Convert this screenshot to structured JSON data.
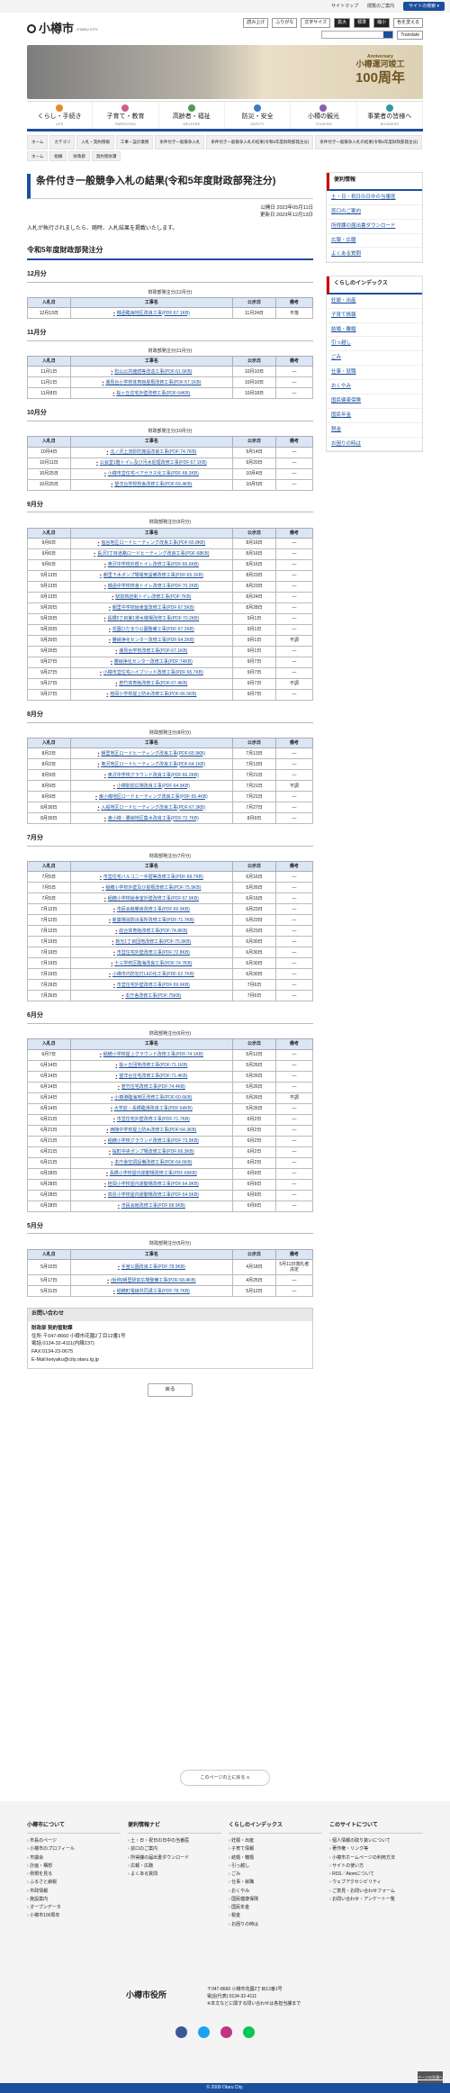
{
  "topbar": {
    "sitemap": "サイトマップ",
    "howto": "閲覧のご案内",
    "external": "サイトの検索 ▾"
  },
  "header": {
    "city": "小樽市",
    "city_en": "OTARU CITY",
    "tools": [
      "読み上げ",
      "ふりがな",
      "文字サイズ",
      "拡大",
      "標準",
      "縮小",
      "色を変える"
    ],
    "search_label": "サイト内検索",
    "translate": "Translate"
  },
  "banner": {
    "line1": "Anniversary",
    "line2": "小樽運河竣工",
    "line3": "100周年"
  },
  "gnav": [
    {
      "label": "くらし・手続き",
      "sub": "LIFE"
    },
    {
      "label": "子育て・教育",
      "sub": "PARENTING"
    },
    {
      "label": "高齢者・福祉",
      "sub": "WELFARE"
    },
    {
      "label": "防災・安全",
      "sub": "SAFETY"
    },
    {
      "label": "小樽の観光",
      "sub": "TOURISM"
    },
    {
      "label": "事業者の皆様へ",
      "sub": "BUSINESS"
    }
  ],
  "breadcrumb": [
    "ホーム",
    "カテゴリ",
    "入札・契約情報",
    "工事・設計業務",
    "条件付き一般競争入札",
    "条件付き一般競争入札の結果(令和5年度財政部発注分)",
    "条件付き一般競争入札の結果(令和5年度財政部発注分)"
  ],
  "breadcrumb2": [
    "ホーム",
    "組織",
    "財政部",
    "契約管財課"
  ],
  "page": {
    "title": "条件付き一般競争入札の結果(令和5年度財政部発注分)",
    "published": "公開日 2023年05月11日",
    "updated": "更新日 2023年12月13日",
    "intro": "入札が執行されましたら、随時、入札結果を掲載いたします。",
    "section": "令和5年度財政部発注分"
  },
  "table_headers": {
    "date": "入札日",
    "work": "工事名",
    "notice": "公示日",
    "remark": "備考"
  },
  "months": [
    {
      "title": "12月分",
      "caption": "財政部発注分(12月分)",
      "rows": [
        [
          "12月13日",
          "銭函臨海地区改良工事(PDF:67.1KB)",
          "11月24日",
          "不落"
        ]
      ]
    },
    {
      "title": "11月分",
      "caption": "財政部発注分(11月分)",
      "rows": [
        [
          "11月1日",
          "松山公共継続等改造工事(PDF:61.6KB)",
          "10月10日",
          "―"
        ],
        [
          "11月1日",
          "潮見台小学校体育館屋根改修工事(PDF:57.1KB)",
          "10月10日",
          "―"
        ],
        [
          "11月8日",
          "桜ヶ丘住宅外壁改修工事(PDF:64KB)",
          "10月18日",
          "―"
        ]
      ]
    },
    {
      "title": "10月分",
      "caption": "財政部発注分(10月分)",
      "rows": [
        [
          "10月4日",
          "北ノ沢上流砂防施設改良工事(PDF:74.7KB)",
          "9月14日",
          "―"
        ],
        [
          "10月11日",
          "公会堂1階トイレ及び汚水処理改修工事(PDF:67.1KB)",
          "9月20日",
          "―"
        ],
        [
          "10月25日",
          "小樽市営住宅ペアガラス化工事(PDF:68.3KB)",
          "10月4日",
          "―"
        ],
        [
          "10月25日",
          "望洋台学校校舎改修工事(PDF:69.4KB)",
          "10月5日",
          "―"
        ]
      ]
    },
    {
      "title": "9月分",
      "caption": "財政部発注分(9月分)",
      "rows": [
        [
          "9月6日",
          "塩谷地区ロードヒーティング改良工事(PDF:65.8KB)",
          "8月16日",
          "―"
        ],
        [
          "9月6日",
          "長沢3丁目道路ロードヒーティング改良工事(PDF:68KB)",
          "8月16日",
          "―"
        ],
        [
          "9月6日",
          "奥沢中学校外部トイレ改修工事(PDF:66.6KB)",
          "8月16日",
          "―"
        ],
        [
          "9月13日",
          "朝里下水ポンプ場電気設備改修工事(PDF:65.1KB)",
          "8月23日",
          "―"
        ],
        [
          "9月13日",
          "銭函中学校校舎トイレ改修工事(PDF:70.2KB)",
          "8月23日",
          "―"
        ],
        [
          "9月13日",
          "駅前商店街トイレ改修工事(PDF:7KB)",
          "8月24日",
          "―"
        ],
        [
          "9月20日",
          "朝里中学校給食室改修工事(PDF:67.5KB)",
          "8月28日",
          "―"
        ],
        [
          "9月20日",
          "長橋5丁目第1排水機場改修工事(PDF:70.2KB)",
          "9月1日",
          "―"
        ],
        [
          "9月20日",
          "花園ひだまり公園整備工事(PDF:67.2KB)",
          "9月1日",
          "―"
        ],
        [
          "9月20日",
          "勝納浄化センター改修工事(PDF:64.2KB)",
          "9月1日",
          "不調"
        ],
        [
          "9月20日",
          "潮見台学校改修工事(PDF:67.1KB)",
          "9月1日",
          "―"
        ],
        [
          "9月27日",
          "勝納浄化センター改修工事(PDF:74KB)",
          "9月7日",
          "―"
        ],
        [
          "9月27日",
          "小樽市営住宅ハイブリッド改修工事(PDF:65.7KB)",
          "9月7日",
          "―"
        ],
        [
          "9月27日",
          "若竹体育館改修工事(PDF:67.4KB)",
          "9月7日",
          "不調"
        ],
        [
          "9月27日",
          "桂岡小学校屋上防水改修工事(PDF:66.5KB)",
          "9月7日",
          "―"
        ]
      ]
    },
    {
      "title": "8月分",
      "caption": "財政部発注分(8月分)",
      "rows": [
        [
          "8月2日",
          "朝里地区ロードヒーティング改良工事(PDF:65.9KB)",
          "7月13日",
          "―"
        ],
        [
          "8月2日",
          "奥沢地区ロードヒーティング改良工事(PDF:64.1KB)",
          "7月13日",
          "―"
        ],
        [
          "8月9日",
          "奥沢中学校グラウンド改良工事(PDF:66.2KB)",
          "7月21日",
          "―"
        ],
        [
          "8月9日",
          "小樽駅前広場改良工事(PDF:64.9KB)",
          "7月21日",
          "不調"
        ],
        [
          "8月9日",
          "東小樽地区ロードヒーティング改良工事(PDF:65.4KB)",
          "7月21日",
          "―"
        ],
        [
          "8月30日",
          "入船地区ロードヒーティング改良工事(PDF:67.3KB)",
          "7月27日",
          "―"
        ],
        [
          "8月30日",
          "東小樽・勝納地区集水改良工事(PDF:72.7KB)",
          "8月9日",
          "―"
        ]
      ]
    },
    {
      "title": "7月分",
      "caption": "財政部発注分(7月分)",
      "rows": [
        [
          "7月5日",
          "市営住宅バルコニー手摺等改修工事(PDF:69.7KB)",
          "6月16日",
          "―"
        ],
        [
          "7月5日",
          "稲穂小学校外壁及び屋根改修工事(PDF:75.9KB)",
          "5月26日",
          "―"
        ],
        [
          "7月5日",
          "稲穂小学校給食室外壁改修工事(PDF:67.9KB)",
          "6月16日",
          "―"
        ],
        [
          "7月12日",
          "市民会館暖房改修工事(PDF:69.9KB)",
          "6月23日",
          "―"
        ],
        [
          "7月12日",
          "新築場消防出張所改修工事(PDF:71.7KB)",
          "6月23日",
          "―"
        ],
        [
          "7月12日",
          "総合体育館改修工事(PDF:74.8KB)",
          "6月23日",
          "―"
        ],
        [
          "7月19日",
          "新光1丁目団地改修工事(PDF:75.9KB)",
          "6月30日",
          "―"
        ],
        [
          "7月19日",
          "市営住宅外壁改修工事(PDF:72.8KB)",
          "6月30日",
          "―"
        ],
        [
          "7月19日",
          "十三学校区臨海改良工事(PDF:74.7KB)",
          "6月30日",
          "―"
        ],
        [
          "7月19日",
          "小樽市内防犯灯LED化工事(PDF:62.7KB)",
          "6月30日",
          "―"
        ],
        [
          "7月26日",
          "市営住宅外壁改修工事(PDF:69.6KB)",
          "7月6日",
          "―"
        ],
        [
          "7月26日",
          "本庁舎改修工事(PDF:75KB)",
          "7月6日",
          "―"
        ]
      ]
    },
    {
      "title": "6月分",
      "caption": "財政部発注分(6月分)",
      "rows": [
        [
          "6月7日",
          "稲穂小学校屋上グラウンド改修工事(PDF:74.1KB)",
          "5月12日",
          "―"
        ],
        [
          "6月14日",
          "桜ヶ丘団地改修工事(PDF:71.1KB)",
          "5月26日",
          "―"
        ],
        [
          "6月14日",
          "望洋台住宅改修工事(PDF:71.4KB)",
          "5月26日",
          "―"
        ],
        [
          "6月14日",
          "若竹住宅改修工事(PDF:74.4KB)",
          "5月26日",
          "―"
        ],
        [
          "6月14日",
          "小樽港臨海地区改修工事(PDF:60.6KB)",
          "5月26日",
          "不調"
        ],
        [
          "6月14日",
          "大学前・長橋臨港改良工事(PDF:64KB)",
          "5月26日",
          "―"
        ],
        [
          "6月21日",
          "市営住宅外壁改修工事(PDF:71.7KB)",
          "6月2日",
          "―"
        ],
        [
          "6月21日",
          "西陵中学校屋上防水改修工事(PDF:64.3KB)",
          "6月2日",
          "―"
        ],
        [
          "6月21日",
          "稲穂小学校グラウンド改修工事(PDF:73.9KB)",
          "6月2日",
          "―"
        ],
        [
          "6月21日",
          "桜町中央ポンプ場改修工事(PDF:66.3KB)",
          "6月2日",
          "―"
        ],
        [
          "6月21日",
          "本庁舎空調設備改修工事(PDF:64.6KB)",
          "6月2日",
          "―"
        ],
        [
          "6月28日",
          "長橋小学校屋内運動場改修工事(PDF:69KB)",
          "6月9日",
          "―"
        ],
        [
          "6月28日",
          "桂岡小学校屋内運動場改修工事(PDF:64.9KB)",
          "6月9日",
          "―"
        ],
        [
          "6月28日",
          "高島小学校屋内運動場改修工事(PDF:64.5KB)",
          "6月9日",
          "―"
        ],
        [
          "6月28日",
          "市民会館改修工事(PDF:68.9KB)",
          "6月9日",
          "―"
        ]
      ]
    },
    {
      "title": "5月分",
      "caption": "財政部発注分(5月分)",
      "rows": [
        [
          "5月10日",
          "手宮公園改良工事(PDF:78.9KB)",
          "4月18日",
          "5月11日落札者決定"
        ],
        [
          "5月17日",
          "(仮称)朝里駅前広場整備工事(PDF:68.4KB)",
          "4月25日",
          "―"
        ],
        [
          "5月31日",
          "稲穂町電線共同溝工事(PDF:78.7KB)",
          "5月12日",
          "―"
        ]
      ]
    }
  ],
  "contact": {
    "title": "お問い合わせ",
    "dept": "財政部 契約管財課",
    "lines": [
      "住所:〒047-8660 小樽市花園2丁目12番1号",
      "電話:0134-32-4111(内線237)",
      "FAX:0134-23-0675",
      "E-Mail:keiyaku@city.otaru.lg.jp"
    ]
  },
  "back": "戻る",
  "side1": {
    "title": "便利情報",
    "links": [
      "土・日・祝日の日中の当番医",
      "窓口のご案内",
      "所得課の届出書ダウンロード",
      "広報・広聴",
      "よくある質問"
    ]
  },
  "side2": {
    "title": "くらしのインデックス",
    "links": [
      "妊娠・出産",
      "子育て情報",
      "結婚・離婚",
      "引っ越し",
      "ごみ",
      "仕事・就職",
      "おくやみ",
      "国民健康保険",
      "国民年金",
      "税金",
      "お困りの時は"
    ]
  },
  "gotop": "このページの上に戻る ∧",
  "footer": {
    "cols": [
      {
        "title": "小樽市について",
        "links": [
          "市長のページ",
          "小樽市のプロフィール",
          "市議会",
          "計画・構想",
          "例規を見る",
          "ふるさと納税",
          "市政情報",
          "施設案内",
          "オープンデータ",
          "小樽市100周年"
        ]
      },
      {
        "title": "便利情報ナビ",
        "links": [
          "土・日・祝日の日中の当番医",
          "窓口のご案内",
          "所得課の届出書ダウンロード",
          "広報・広聴",
          "よくある質問"
        ]
      },
      {
        "title": "くらしのインデックス",
        "links": [
          "妊娠・出産",
          "子育て情報",
          "結婚・離婚",
          "引っ越し",
          "ごみ",
          "仕事・就職",
          "おくやみ",
          "国民健康保険",
          "国民年金",
          "税金",
          "お困りの時は"
        ]
      },
      {
        "title": "このサイトについて",
        "links": [
          "個人情報の取り扱いについて",
          "著作権・リンク等",
          "小樽市ホームページの利用方法",
          "サイトの使い方",
          "RSS／Atomについて",
          "ウェブアクセシビリティ",
          "ご意見・お問い合わせフォーム",
          "お問い合わせ・アンケート一覧"
        ]
      }
    ],
    "name": "小樽市役所",
    "address": "〒047-8660 小樽市花園2丁目12番1号",
    "tel": "電話(代表):0134-32-4111",
    "note": "※本文などに関する問い合わせは各担当課まで",
    "copyright": "© 2009 Otaru City.",
    "pagetop": "ページの先頭へ"
  },
  "colors": {
    "accent": "#1b4f9c",
    "header_bg": "#dbe6f4",
    "footer_bar": "#1b4f9c"
  }
}
